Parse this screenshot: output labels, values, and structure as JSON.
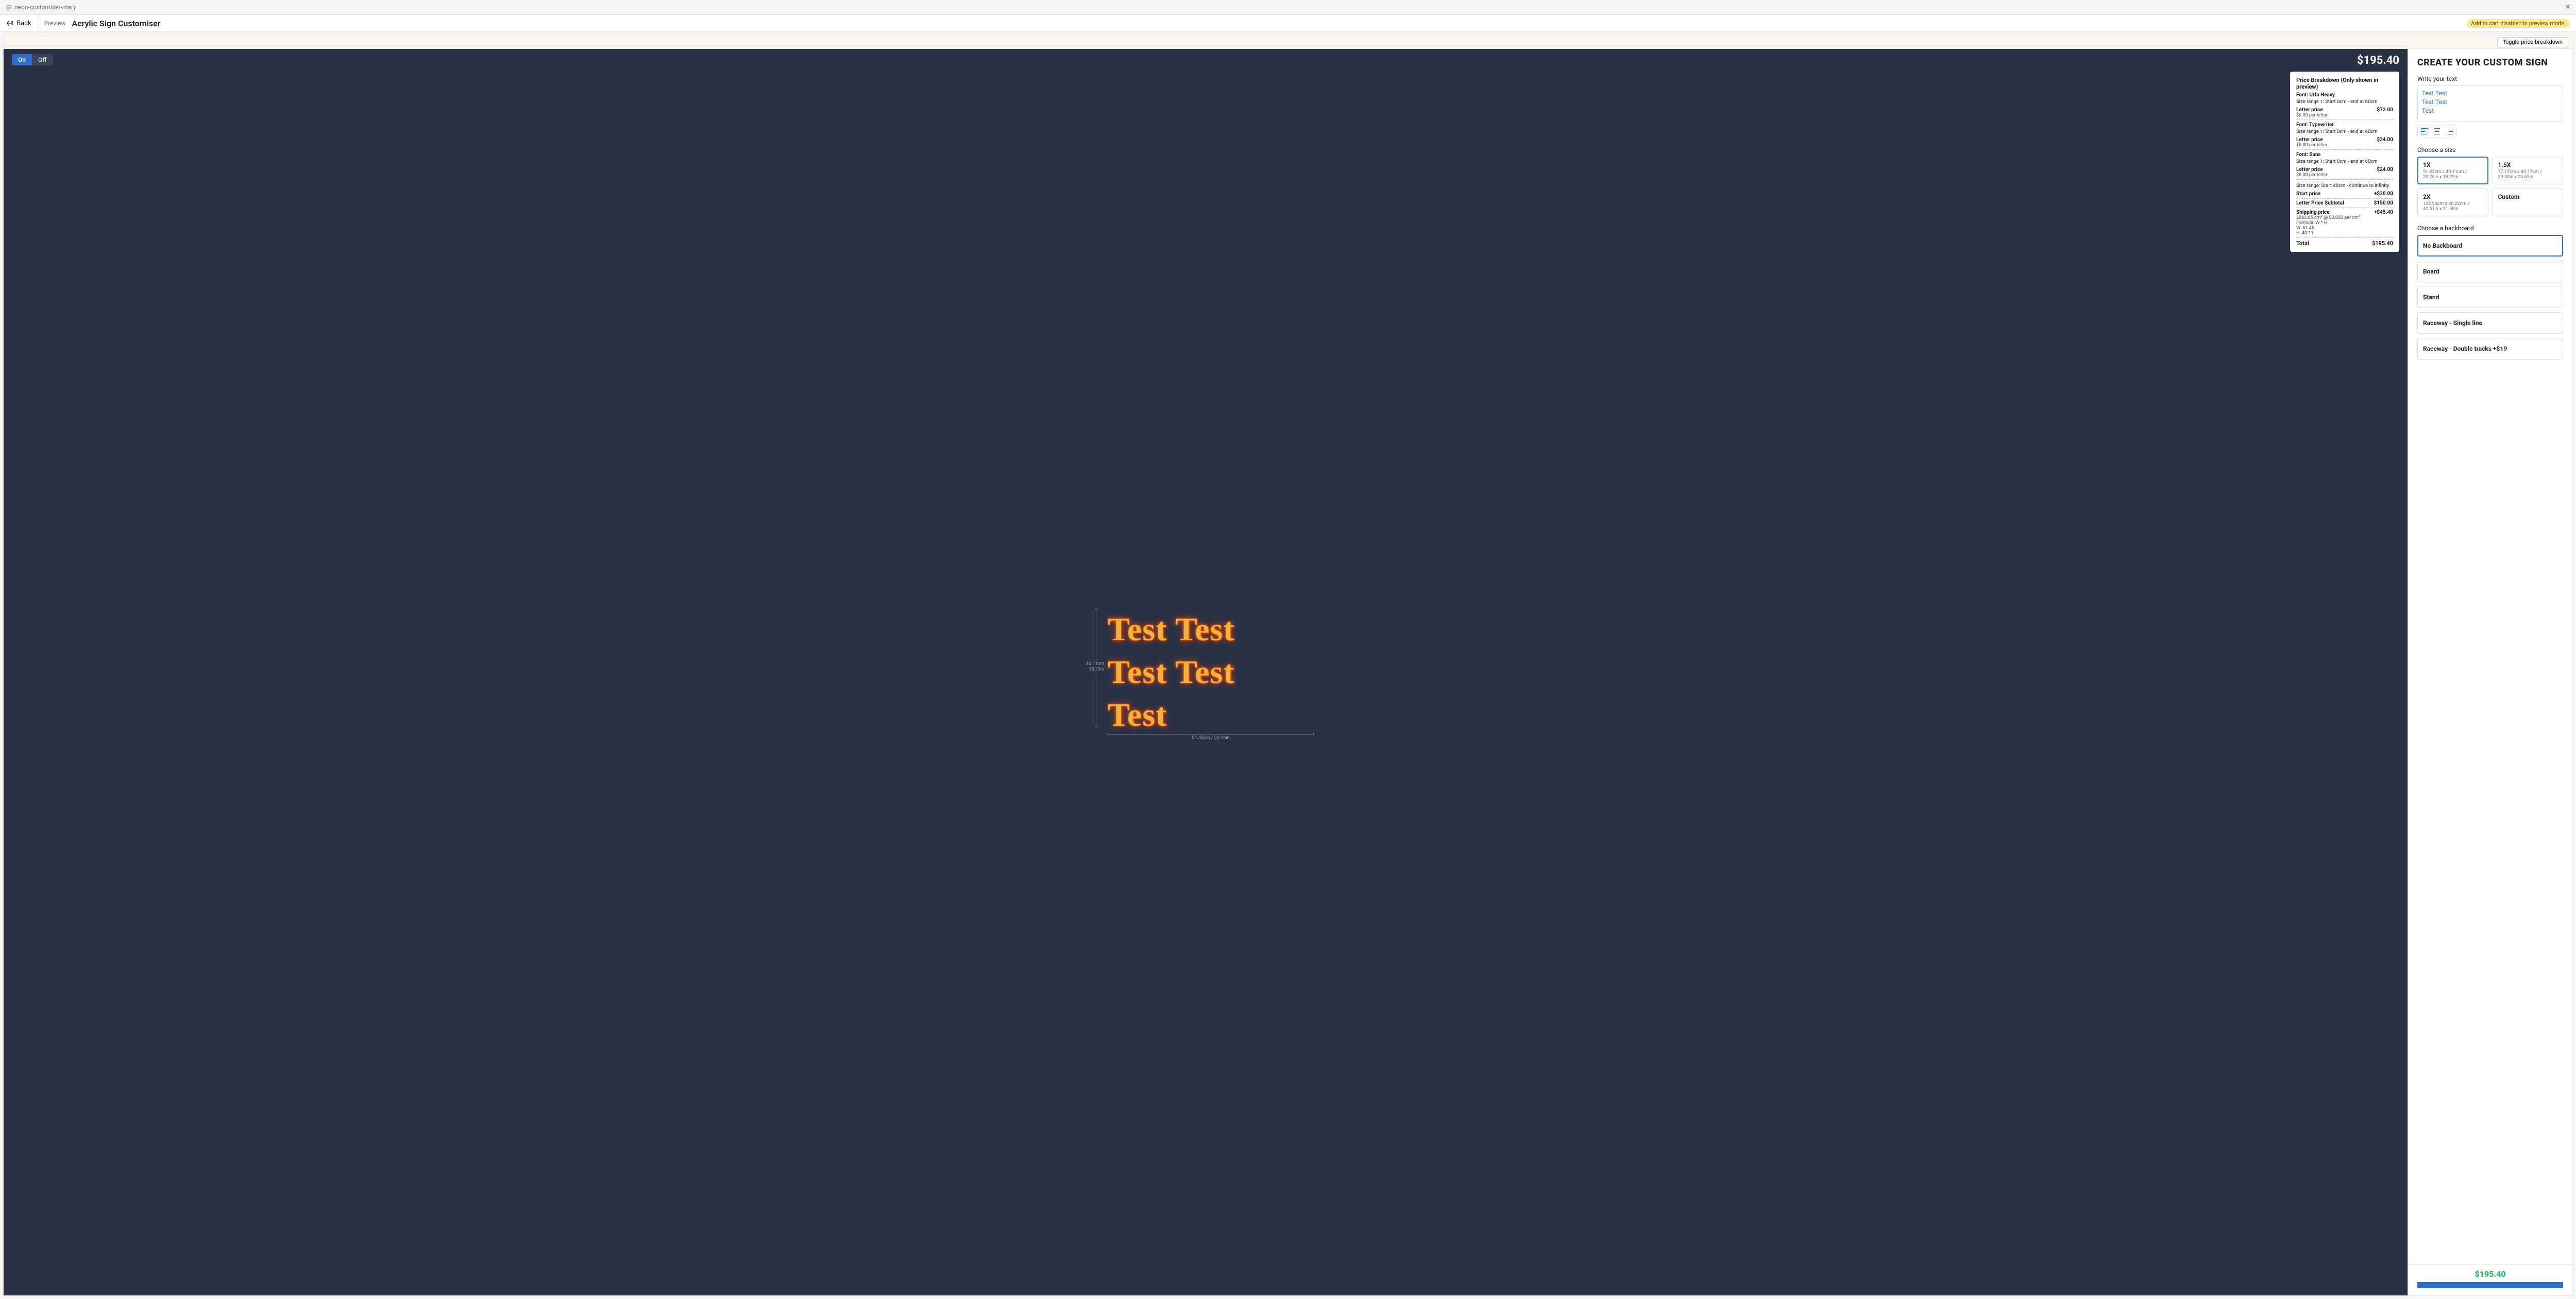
{
  "header": {
    "project_name": "neon-customiser-mary",
    "back_label": "Back",
    "preview_label": "Preview",
    "page_title": "Acrylic Sign Customiser",
    "cart_notice": "Add to cart disabled in preview mode.",
    "toggle_breakdown_label": "Toggle price breakdown"
  },
  "canvas": {
    "on_label": "On",
    "off_label": "Off",
    "price": "$195.40",
    "lines": [
      "Test Test",
      "Test Test",
      "Test"
    ],
    "measure": {
      "height_cm": "40.11cm",
      "height_in": "15.79in",
      "width": "51.45cm / 20.26in"
    }
  },
  "breakdown": {
    "title": "Price Breakdown (Only shown in preview)",
    "fonts": [
      {
        "label": "Font: Urfa Heavy",
        "range": "Size range 1: Start 0cm - end at 60cm",
        "letter_price_label": "Letter price",
        "letter_price_sub": "$6.00 per letter",
        "amount": "$72.00"
      },
      {
        "label": "Font: Typewriter",
        "range": "Size range 1: Start 0cm - end at 60cm",
        "letter_price_label": "Letter price",
        "letter_price_sub": "$6.00 per letter",
        "amount": "$24.00"
      },
      {
        "label": "Font: Sans",
        "range": "Size range 1: Start 0cm - end at 60cm",
        "letter_price_label": "Letter price",
        "letter_price_sub": "$6.00 per letter",
        "amount": "$24.00"
      }
    ],
    "size_range_label": "Size range: Start 40cm - continue to infinity",
    "start_price_label": "Start price",
    "start_price": "+$30.00",
    "subtotal_label": "Letter Price Subtotal",
    "subtotal": "$150.00",
    "shipping_label": "Shipping price",
    "shipping_sub1": "2063.65 cm² @ $0.022 per cm²",
    "shipping_sub2": "Formula: W * H",
    "shipping_sub3": "W: 51.45",
    "shipping_sub4": "H: 40.11",
    "shipping_amount": "+$45.40",
    "total_label": "Total",
    "total": "$195.40"
  },
  "sidebar": {
    "main_title": "CREATE YOUR CUSTOM SIGN",
    "text_label": "Write your text",
    "text_value": "Test Test\nTest Test\nTest",
    "size_label": "Choose a size",
    "sizes": [
      {
        "name": "1X",
        "dims": "51.45cm x 40.11cm / 20.26in x 15.79in"
      },
      {
        "name": "1.5X",
        "dims": "77.17cm x 60.17cm / 30.38in x 23.69in"
      },
      {
        "name": "2X",
        "dims": "102.90cm x 80.22cm / 40.51in x 31.58in"
      },
      {
        "name": "Custom",
        "dims": ""
      }
    ],
    "backboard_label": "Choose a backboard",
    "backboards": [
      "No Backboard",
      "Board",
      "Stand",
      "Raceway - Single line",
      "Raceway - Double tracks +$19"
    ],
    "footer_price": "$195.40"
  }
}
